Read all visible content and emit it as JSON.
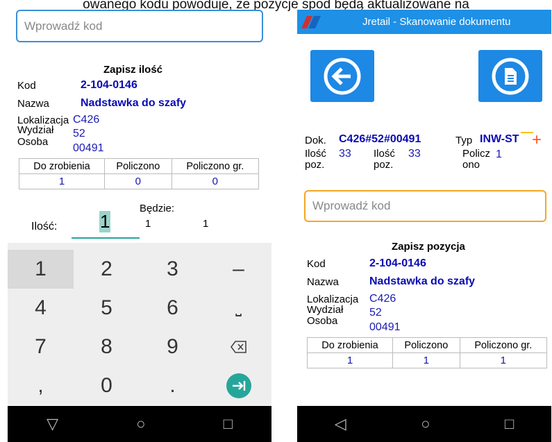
{
  "caption": "owanego kodu powoduje, że pozycje spod będą aktualizowane na",
  "left": {
    "search_placeholder": "Wprowadź kod",
    "section_title": "Zapisz ilość",
    "fields": {
      "kod_label": "Kod",
      "kod_value": "2-104-0146",
      "nazwa_label": "Nazwa",
      "nazwa_value": "Nadstawka do szafy",
      "lok_label": "Lokalizacja",
      "lok_value": "C426",
      "wydz_label": "Wydział",
      "wydz_value": "52",
      "osoba_label": "Osoba",
      "osoba_value": "00491"
    },
    "table": {
      "headers": [
        "Do zrobienia",
        "Policzono",
        "Policzono gr."
      ],
      "values": [
        "1",
        "0",
        "0"
      ]
    },
    "qty": {
      "label": "Ilość:",
      "value": "1",
      "bedzie_label": "Będzie:",
      "bedzie_a": "1",
      "bedzie_b": "1"
    },
    "keys": {
      "k1": "1",
      "k2": "2",
      "k3": "3",
      "k4": "4",
      "k5": "5",
      "k6": "6",
      "k7": "7",
      "k8": "8",
      "k9": "9",
      "k0": "0",
      "minus": "–",
      "space": "⎵",
      "comma": ",",
      "dot": "."
    },
    "nav": {
      "back": "▽",
      "home": "○",
      "recent": "□"
    }
  },
  "right": {
    "app_title": "Jretail - Skanowanie dokumentu",
    "dok": {
      "dok_label": "Dok.",
      "dok_value": "C426#52#00491",
      "typ_label": "Typ",
      "typ_value": "INW-ST",
      "ilosc1_label_a": "Ilość",
      "ilosc1_label_b": "poz.",
      "ilosc1_value": "33",
      "ilosc2_label_a": "Ilość",
      "ilosc2_label_b": "poz.",
      "ilosc2_value": "33",
      "policz_label_a": "Policz",
      "policz_label_b": "ono",
      "policz_value": "1"
    },
    "search_placeholder": "Wprowadź kod",
    "section_title": "Zapisz pozycja",
    "fields": {
      "kod_label": "Kod",
      "kod_value": "2-104-0146",
      "nazwa_label": "Nazwa",
      "nazwa_value": "Nadstawka do szafy",
      "lok_label": "Lokalizacja",
      "lok_value": "C426",
      "wydz_label": "Wydział",
      "wydz_value": "52",
      "osoba_label": "Osoba",
      "osoba_value": "00491"
    },
    "table": {
      "headers": [
        "Do zrobienia",
        "Policzono",
        "Policzono gr."
      ],
      "values": [
        "1",
        "1",
        "1"
      ]
    },
    "nav": {
      "back": "◁",
      "home": "○",
      "recent": "□"
    }
  },
  "colors": {
    "accent_blue": "#1e88e5",
    "value_blue": "#0a0ab4",
    "teal": "#26a69a",
    "orange_focus": "#f5a623",
    "plus_orange": "#ff5722"
  }
}
